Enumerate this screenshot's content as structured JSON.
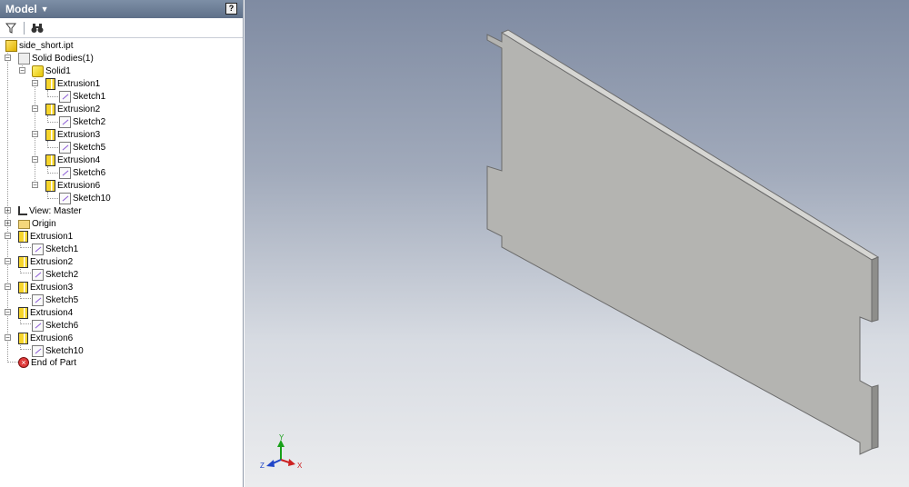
{
  "panel": {
    "title": "Model",
    "help_label": "?",
    "toolbar": {
      "filter_icon": "filter-icon",
      "search_icon": "binoculars-icon"
    }
  },
  "tree": {
    "part": "side_short.ipt",
    "solid_bodies": "Solid Bodies(1)",
    "solid": "Solid1",
    "body_features": [
      {
        "extrusion": "Extrusion1",
        "sketch": "Sketch1"
      },
      {
        "extrusion": "Extrusion2",
        "sketch": "Sketch2"
      },
      {
        "extrusion": "Extrusion3",
        "sketch": "Sketch5"
      },
      {
        "extrusion": "Extrusion4",
        "sketch": "Sketch6"
      },
      {
        "extrusion": "Extrusion6",
        "sketch": "Sketch10"
      }
    ],
    "view": "View: Master",
    "origin": "Origin",
    "features": [
      {
        "extrusion": "Extrusion1",
        "sketch": "Sketch1"
      },
      {
        "extrusion": "Extrusion2",
        "sketch": "Sketch2"
      },
      {
        "extrusion": "Extrusion3",
        "sketch": "Sketch5"
      },
      {
        "extrusion": "Extrusion4",
        "sketch": "Sketch6"
      },
      {
        "extrusion": "Extrusion6",
        "sketch": "Sketch10"
      }
    ],
    "end": "End of Part"
  },
  "viewport": {
    "triad": {
      "x": "X",
      "y": "Y",
      "z": "Z"
    },
    "colors": {
      "x_axis": "#cc2020",
      "y_axis": "#19a019",
      "z_axis": "#2046c8",
      "part_face": "#b4b4b1",
      "part_edge": "#6b6b6b"
    }
  }
}
